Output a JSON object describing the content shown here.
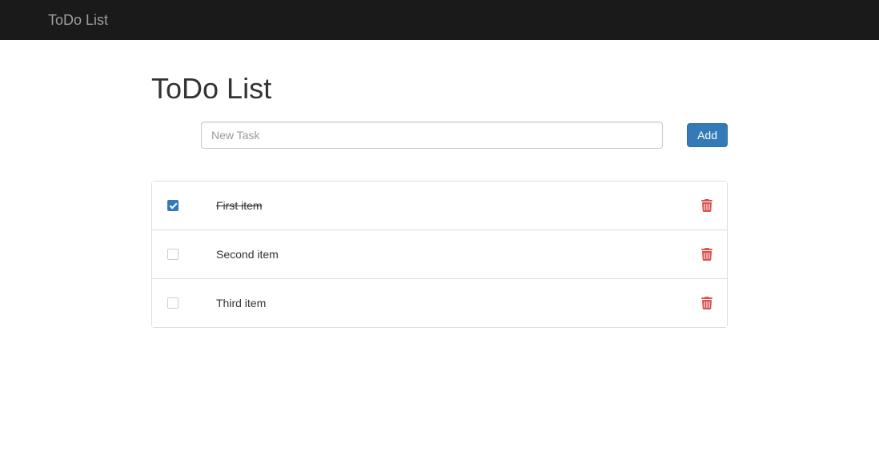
{
  "navbar": {
    "brand": "ToDo List"
  },
  "page": {
    "title": "ToDo List"
  },
  "form": {
    "placeholder": "New Task",
    "value": "",
    "add_label": "Add"
  },
  "tasks": [
    {
      "label": "First item",
      "done": true
    },
    {
      "label": "Second item",
      "done": false
    },
    {
      "label": "Third item",
      "done": false
    }
  ],
  "colors": {
    "primary": "#337ab7",
    "danger": "#d9534f",
    "navbar_bg": "#1a1a1a"
  }
}
